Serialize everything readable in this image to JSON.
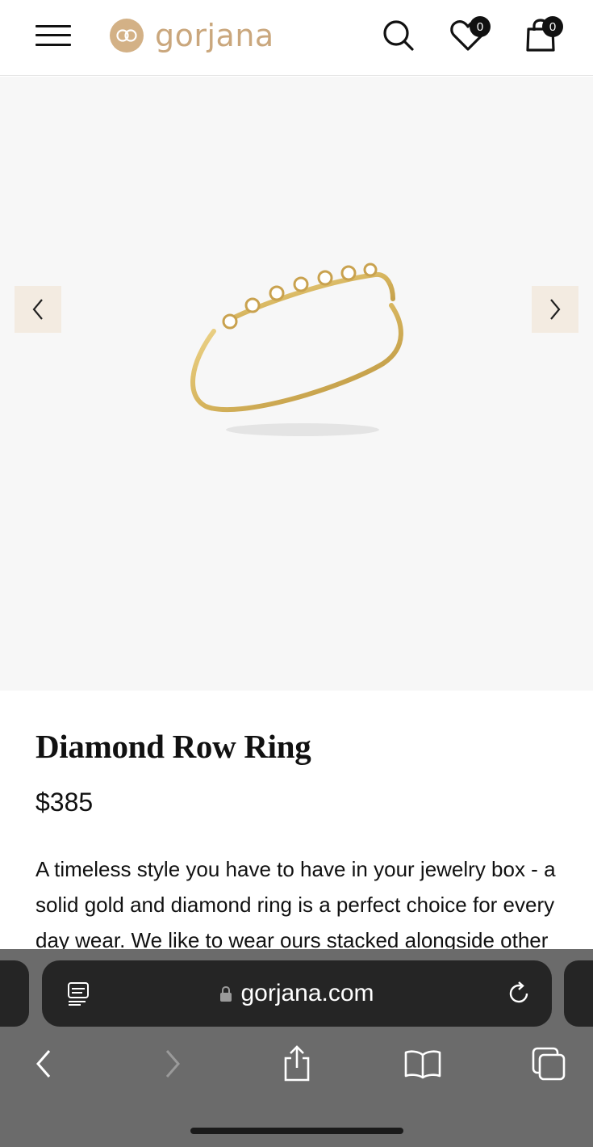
{
  "header": {
    "logo_text": "gorjana",
    "logo_mark_text": "gg",
    "wishlist_count": "0",
    "cart_count": "0"
  },
  "product": {
    "title": "Diamond Row Ring",
    "price": "$385",
    "description": "A timeless style you have to have in your jewelry box - a solid gold and diamond ring is a perfect choice for every day wear. We like to wear ours stacked alongside other"
  },
  "browser": {
    "url": "gorjana.com"
  },
  "colors": {
    "brand": "#caa77d",
    "arrow_bg": "#f3ebe1",
    "gallery_bg": "#f7f7f7"
  },
  "icons": {
    "menu": "hamburger-icon",
    "search": "search-icon",
    "wishlist": "heart-icon",
    "cart": "shopping-bag-icon",
    "prev": "chevron-left-icon",
    "next": "chevron-right-icon",
    "reader": "reader-mode-icon",
    "reload": "reload-icon",
    "back": "back-icon",
    "forward": "forward-icon",
    "share": "share-icon",
    "bookmarks": "bookmarks-icon",
    "tabs": "tabs-icon"
  }
}
